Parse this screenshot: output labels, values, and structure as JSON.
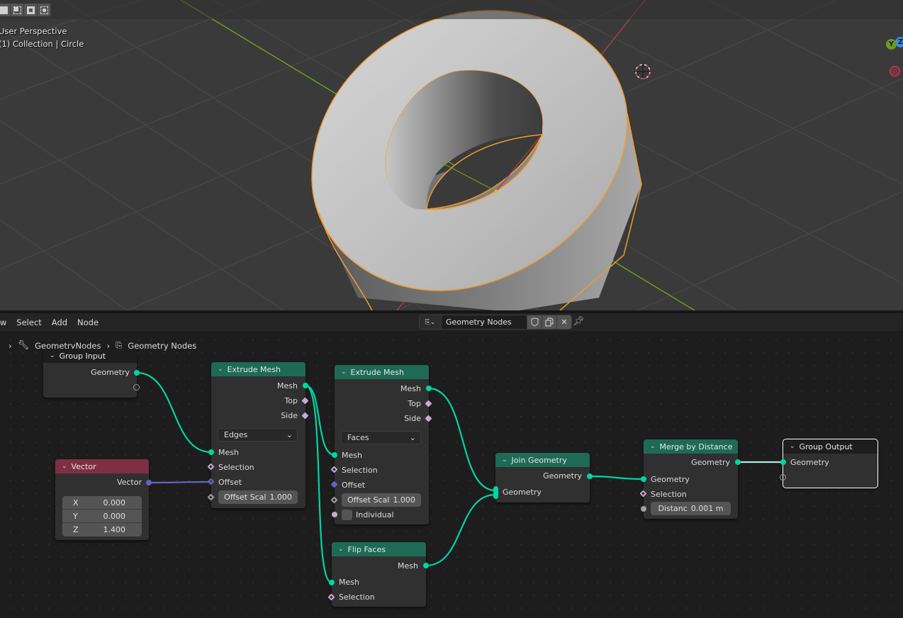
{
  "viewport": {
    "select_modes": [
      "select-new-icon",
      "select-extend-icon",
      "select-subtract-icon",
      "select-intersect-icon"
    ],
    "view_label": "User Perspective",
    "collection_label": "(1) Collection | Circle",
    "gizmo": {
      "y_label": "Y",
      "z_label": "Z"
    },
    "colors": {
      "selection_outline": "#f39a2c",
      "x_axis": "#a5414f",
      "y_axis": "#6e9a23",
      "background": "#3a3a3a"
    }
  },
  "node_header": {
    "menus": [
      "View",
      "Select",
      "Add",
      "Node"
    ],
    "tree_name": "Geometry Nodes",
    "buttons": {
      "fake_user": "shield-icon",
      "duplicate": "duplicate-icon",
      "unlink": "✕",
      "pin": "pin-icon"
    }
  },
  "breadcrumb": {
    "modifier": "GeometryNodes",
    "tree": "Geometry Nodes"
  },
  "nodes": {
    "group_input": {
      "title": "Group Input",
      "outputs": [
        "Geometry"
      ]
    },
    "vector": {
      "title": "Vector",
      "output": "Vector",
      "x_label": "X",
      "x": "0.000",
      "y_label": "Y",
      "y": "0.000",
      "z_label": "Z",
      "z": "1.400"
    },
    "extrude1": {
      "title": "Extrude Mesh",
      "outputs": [
        "Mesh",
        "Top",
        "Side"
      ],
      "mode": "Edges",
      "inputs": [
        "Mesh",
        "Selection",
        "Offset"
      ],
      "offset_scale_label": "Offset Scal",
      "offset_scale": "1.000"
    },
    "extrude2": {
      "title": "Extrude Mesh",
      "outputs": [
        "Mesh",
        "Top",
        "Side"
      ],
      "mode": "Faces",
      "inputs": [
        "Mesh",
        "Selection",
        "Offset"
      ],
      "offset_scale_label": "Offset Scal",
      "offset_scale": "1.000",
      "individual_label": "Individual",
      "individual": false
    },
    "flip": {
      "title": "Flip Faces",
      "output": "Mesh",
      "inputs": [
        "Mesh",
        "Selection"
      ]
    },
    "join": {
      "title": "Join Geometry",
      "output": "Geometry",
      "input": "Geometry"
    },
    "merge": {
      "title": "Merge by Distance",
      "output": "Geometry",
      "inputs": [
        "Geometry",
        "Selection"
      ],
      "distance_label": "Distanc",
      "distance": "0.001 m"
    },
    "group_output": {
      "title": "Group Output",
      "input": "Geometry"
    }
  },
  "colors": {
    "geometry_socket": "#00d6a3",
    "vector_socket": "#6363c7",
    "field_socket": "#c9a8d8",
    "geometry_header": "#1e6a55",
    "vector_header": "#7e2f46"
  }
}
